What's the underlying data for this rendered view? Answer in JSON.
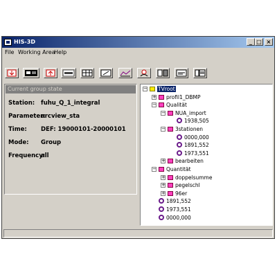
{
  "window": {
    "title": "HIS-3D"
  },
  "window_buttons": {
    "minimize": "_",
    "maximize": "□",
    "close": "×"
  },
  "menu": [
    "File",
    "Working Area",
    "Help"
  ],
  "toolbar": [
    {
      "name": "import-icon"
    },
    {
      "name": "monitor-icon"
    },
    {
      "name": "export-icon"
    },
    {
      "name": "text-icon"
    },
    {
      "name": "grid-icon"
    },
    {
      "name": "edit-icon"
    },
    {
      "name": "graph-icon"
    },
    {
      "name": "person-icon"
    },
    {
      "name": "view1-icon"
    },
    {
      "name": "view2-icon"
    },
    {
      "name": "view3-icon"
    }
  ],
  "group_state": {
    "header": "Current group state",
    "rows": [
      {
        "key": "Station:",
        "value": "fuhu_Q_1_integral"
      },
      {
        "key": "Parameter:",
        "value": "arcview_sta"
      },
      {
        "key": "Time:",
        "value": "DEF: 19000101-20000101"
      },
      {
        "key": "Mode:",
        "value": "Group"
      },
      {
        "key": "Frequency:",
        "value": "all"
      }
    ]
  },
  "tree": [
    {
      "label": "TVroot",
      "kind": "root",
      "exp": "−",
      "level": 0,
      "selected": true
    },
    {
      "label": "profil1_DBMP",
      "kind": "folder",
      "exp": "+",
      "level": 1
    },
    {
      "label": "Qualität",
      "kind": "folder",
      "exp": "−",
      "level": 1
    },
    {
      "label": "NUA_import",
      "kind": "folder",
      "exp": "−",
      "level": 2
    },
    {
      "label": "1938,505",
      "kind": "leaf",
      "level": 3
    },
    {
      "label": "3stationen",
      "kind": "folder",
      "exp": "−",
      "level": 2
    },
    {
      "label": "0000,000",
      "kind": "leaf",
      "level": 3
    },
    {
      "label": "1891,552",
      "kind": "leaf",
      "level": 3
    },
    {
      "label": "1973,551",
      "kind": "leaf",
      "level": 3
    },
    {
      "label": "bearbeiten",
      "kind": "folder",
      "exp": "+",
      "level": 2
    },
    {
      "label": "Quantität",
      "kind": "folder",
      "exp": "−",
      "level": 1
    },
    {
      "label": "doppelsumme",
      "kind": "folder",
      "exp": "+",
      "level": 2
    },
    {
      "label": "pegelschl",
      "kind": "folder",
      "exp": "+",
      "level": 2
    },
    {
      "label": "96er",
      "kind": "folder",
      "exp": "+",
      "level": 2
    },
    {
      "label": "1891,552",
      "kind": "leaf",
      "level": 1
    },
    {
      "label": "1973,551",
      "kind": "leaf",
      "level": 1
    },
    {
      "label": "0000,000",
      "kind": "leaf",
      "level": 1
    }
  ]
}
